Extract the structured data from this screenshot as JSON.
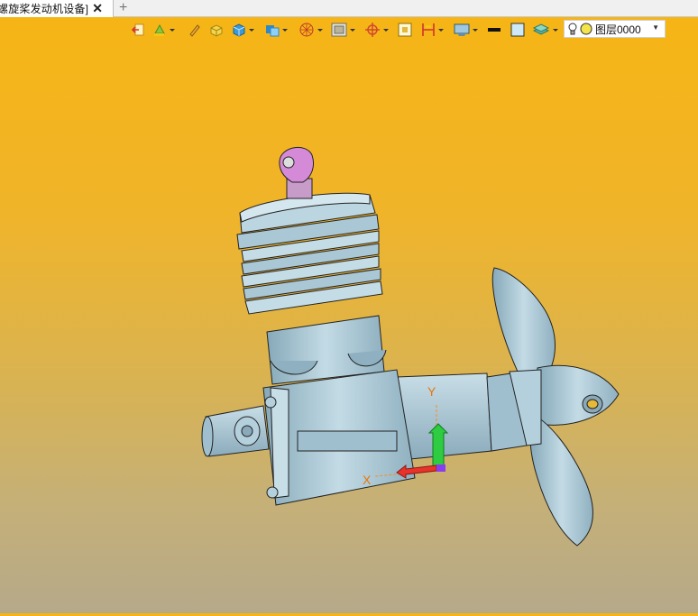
{
  "tab": {
    "title": "螺旋桨发动机设备]",
    "close": "✕",
    "add": "+"
  },
  "toolbar": {
    "layer_value": "图层0000",
    "icons": [
      "exit-icon",
      "paint-icon",
      "pencil-icon",
      "box-icon",
      "cube-icon",
      "shaded-view-icon",
      "sphere-wire-icon",
      "frame-icon",
      "target-icon",
      "rect-select-icon",
      "dimension-icon",
      "display-icon",
      "line-color-icon",
      "fill-color-icon",
      "layer-stack-icon"
    ]
  },
  "axes": {
    "x_label": "X",
    "y_label": "Y"
  },
  "colors": {
    "bg_top": "#f6b513",
    "bg_bottom": "#b6a98a",
    "model": "#aeccd8",
    "spark_plug": "#d58ad8"
  }
}
